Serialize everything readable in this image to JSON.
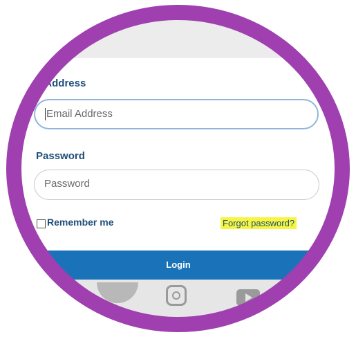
{
  "form": {
    "email_label": "ail Address",
    "email_placeholder": "Email Address",
    "password_label": "Password",
    "password_placeholder": "Password",
    "remember_label": "Remember me",
    "forgot_link": "Forgot password?",
    "login_button": "Login"
  },
  "colors": {
    "ring": "#9f3fb0",
    "label": "#1f4e79",
    "login_button": "#1a73b8",
    "highlight": "#f5f542"
  },
  "icons": [
    "instagram-icon",
    "youtube-icon"
  ]
}
